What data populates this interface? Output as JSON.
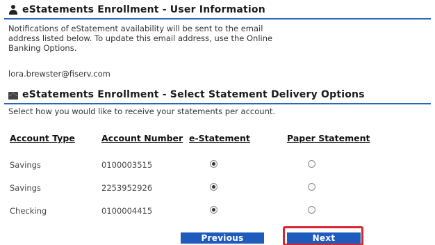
{
  "user_info": {
    "title": "eStatements Enrollment - User Information",
    "icon": "user-icon",
    "notification_line1": "Notifications of eStatement availability will be sent to the email",
    "notification_line2": "address listed below. To update this email address, use the Online",
    "notification_line3": "Banking Options.",
    "email": "lora.brewster@fiserv.com"
  },
  "delivery_options": {
    "title": "eStatements Enrollment - Select Statement Delivery Options",
    "icon": "envelope-icon",
    "instruction": "Select how you would like to receive your statements per account."
  },
  "accounts_table": {
    "headers": [
      "Account Type",
      "Account Number",
      "e-Statement",
      "Paper Statement"
    ],
    "rows": [
      {
        "type": "Savings",
        "number": "0100003515",
        "selected": "e-Statement"
      },
      {
        "type": "Savings",
        "number": "2253952926",
        "selected": "e-Statement"
      },
      {
        "type": "Checking",
        "number": "0100004415",
        "selected": "e-Statement"
      }
    ]
  },
  "buttons": {
    "previous": "Previous",
    "next": "Next"
  },
  "colors": {
    "accent": "#2d66b8",
    "button": "#1e5bbd",
    "highlight": "#d8262b"
  }
}
